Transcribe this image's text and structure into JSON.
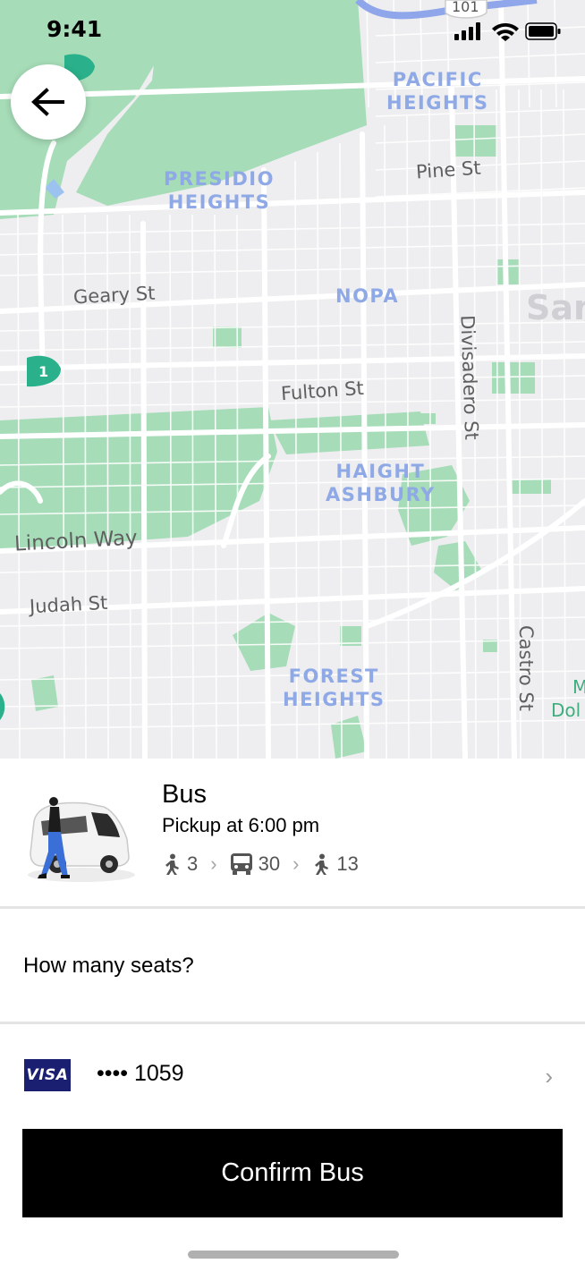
{
  "status_bar": {
    "time": "9:41"
  },
  "map": {
    "neighborhoods": {
      "pacific_heights": [
        "PACIFIC",
        "HEIGHTS"
      ],
      "presidio_heights": [
        "PRESIDIO",
        "HEIGHTS"
      ],
      "nopa": "NOPA",
      "haight_ashbury": [
        "HAIGHT",
        "ASHBURY"
      ],
      "forest_heights": [
        "FOREST",
        "HEIGHTS"
      ]
    },
    "streets": {
      "pine": "Pine St",
      "geary": "Geary St",
      "fulton": "Fulton St",
      "divisadero": "Divisadero St",
      "lincoln": "Lincoln Way",
      "judah": "Judah St",
      "castro": "Castro St"
    },
    "edge_labels": {
      "san": "San",
      "m": "M",
      "dol": "Dol"
    },
    "highway_shield": "101",
    "route_marker": "1"
  },
  "product": {
    "name": "Bus",
    "pickup": "Pickup at 6:00 pm",
    "route": {
      "walk_before": "3",
      "bus": "30",
      "walk_after": "13"
    }
  },
  "seats_question": "How many seats?",
  "payment": {
    "brand": "VISA",
    "card_number": "•••• 1059"
  },
  "confirm_label": "Confirm Bus"
}
